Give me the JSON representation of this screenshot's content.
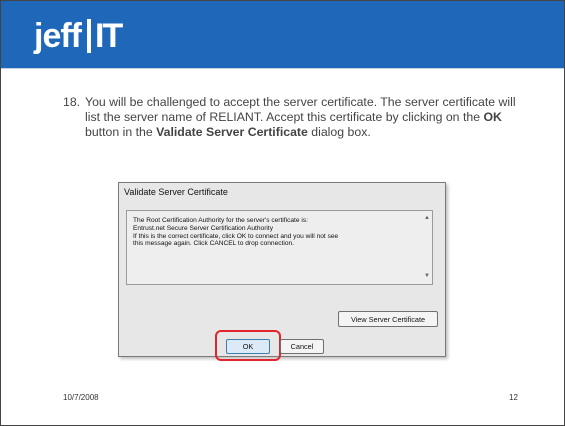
{
  "header": {
    "logo_left": "jeff",
    "logo_right": "IT",
    "colors": {
      "band": "#1f67b9",
      "logo_text": "#ffffff"
    }
  },
  "step": {
    "number": "18.",
    "text_before_ok": "You will be challenged to accept the server certificate. The server certificate will list the server name of RELIANT. Accept this certificate by clicking on the ",
    "ok_label": "OK",
    "text_middle": " button in the ",
    "dialog_name": "Validate Server Certificate",
    "text_after": " dialog box."
  },
  "dialog": {
    "title": "Validate Server Certificate",
    "message_lines": [
      "The Root Certification Authority for the server's certificate is:",
      "Entrust.net Secure Server Certification Authority",
      "If this is the correct certificate, click OK to connect and you will not see",
      "this message again.  Click CANCEL to drop connection."
    ],
    "view_button": "View Server Certificate",
    "ok_button": "OK",
    "cancel_button": "Cancel",
    "highlight_color": "#e0262c"
  },
  "footer": {
    "date": "10/7/2008",
    "page": "12"
  }
}
